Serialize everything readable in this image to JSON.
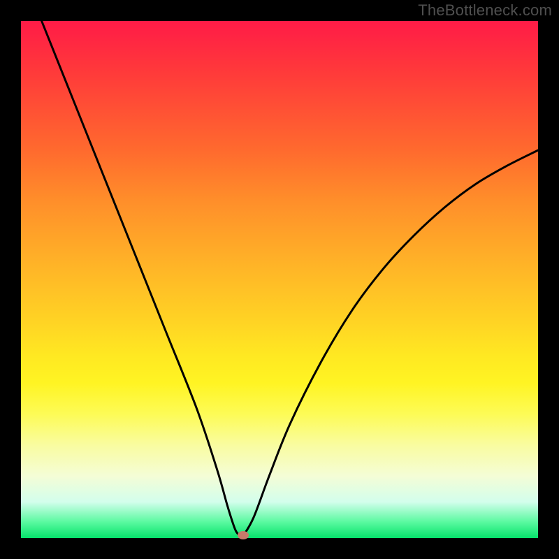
{
  "watermark": "TheBottleneck.com",
  "colors": {
    "background": "#000000",
    "gradient_top": "#ff1b47",
    "gradient_bottom": "#06e26c",
    "curve": "#000000",
    "marker": "#c77a6a"
  },
  "chart_data": {
    "type": "line",
    "title": "",
    "xlabel": "",
    "ylabel": "",
    "xlim": [
      0,
      100
    ],
    "ylim": [
      0,
      100
    ],
    "series": [
      {
        "name": "bottleneck-curve",
        "x": [
          4,
          10,
          16,
          22,
          28,
          34,
          38,
          40,
          41.5,
          42.5,
          43,
          45,
          48,
          52,
          58,
          64,
          70,
          76,
          82,
          88,
          94,
          100
        ],
        "y": [
          100,
          85,
          70,
          55,
          40,
          25,
          13,
          6,
          1.5,
          0.5,
          0.5,
          4,
          12,
          22,
          34,
          44,
          52,
          58.5,
          64,
          68.5,
          72,
          75
        ]
      }
    ],
    "marker": {
      "x": 43,
      "y": 0.5
    },
    "annotations": []
  }
}
